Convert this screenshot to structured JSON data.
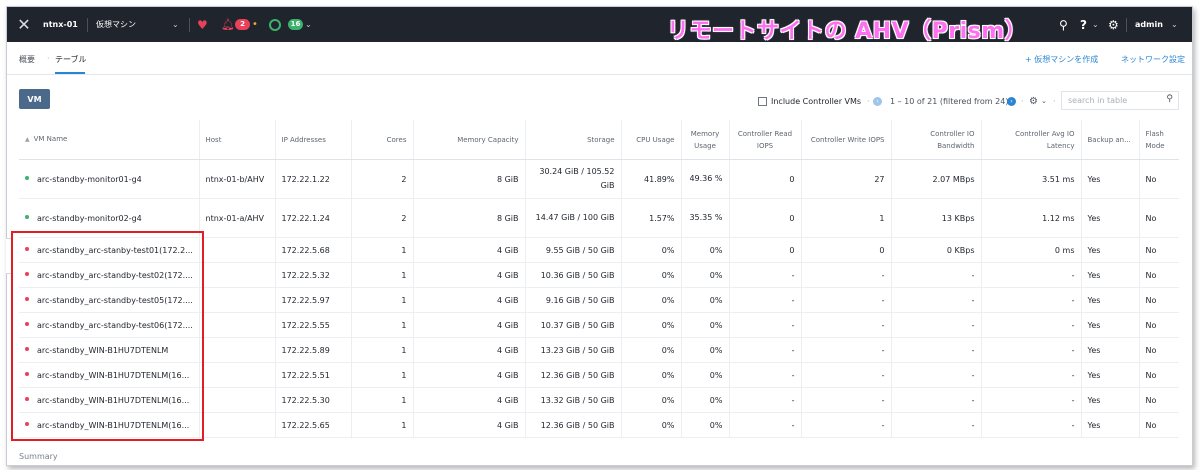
{
  "topbar": {
    "cluster_name": "ntnx-01",
    "menu_label": "仮想マシン",
    "alert_count": "2",
    "task_count": "16",
    "user": "admin",
    "icons": [
      "nutanix-x-logo",
      "heart-icon",
      "bell-icon",
      "circle-icon",
      "search-icon",
      "help-icon",
      "gear-icon"
    ]
  },
  "overlay_title": "リモートサイトの AHV（Prism）",
  "subbar": {
    "tabs": [
      "概要",
      "テーブル"
    ],
    "create_vm": "+ 仮想マシンを作成",
    "network_settings": "ネットワーク設定"
  },
  "toolbar": {
    "vm_tab": "VM",
    "include_controller_vms": "Include Controller VMs",
    "pagination": "1 – 10 of 21 (filtered from 24)",
    "search_placeholder": "search in table"
  },
  "table": {
    "columns": [
      "VM Name",
      "Host",
      "IP Addresses",
      "Cores",
      "Memory Capacity",
      "Storage",
      "CPU Usage",
      "Memory Usage",
      "Controller Read IOPS",
      "Controller Write IOPS",
      "Controller IO Bandwidth",
      "Controller Avg IO Latency",
      "Backup an...",
      "Flash Mode"
    ],
    "rows": [
      {
        "name": "arc-standby-monitor01-g4",
        "host": "ntnx-01-b/AHV",
        "ip": "172.22.1.22",
        "cores": "2",
        "memory": "8 GiB",
        "storage": "30.24 GiB / 105.52 GiB",
        "cpu": "41.89%",
        "mem_usage": "49.36 %",
        "read_iops": "0",
        "write_iops": "27",
        "io_bw": "2.07 MBps",
        "latency": "3.51 ms",
        "backup": "Yes",
        "flash": "No"
      },
      {
        "name": "arc-standby-monitor02-g4",
        "host": "ntnx-01-a/AHV",
        "ip": "172.22.1.24",
        "cores": "2",
        "memory": "8 GiB",
        "storage": "14.47 GiB / 100 GiB",
        "cpu": "1.57%",
        "mem_usage": "35.35 %",
        "read_iops": "0",
        "write_iops": "1",
        "io_bw": "13 KBps",
        "latency": "1.12 ms",
        "backup": "Yes",
        "flash": "No"
      },
      {
        "name": "arc-standby_arc-stanby-test01(172.2...",
        "host": "",
        "ip": "172.22.5.68",
        "cores": "1",
        "memory": "4 GiB",
        "storage": "9.55 GiB / 50 GiB",
        "cpu": "0%",
        "mem_usage": "0%",
        "read_iops": "0",
        "write_iops": "0",
        "io_bw": "0 KBps",
        "latency": "0 ms",
        "backup": "Yes",
        "flash": "No"
      },
      {
        "name": "arc-standby_arc-standby-test02(172....",
        "host": "",
        "ip": "172.22.5.32",
        "cores": "1",
        "memory": "4 GiB",
        "storage": "10.36 GiB / 50 GiB",
        "cpu": "0%",
        "mem_usage": "0%",
        "read_iops": "-",
        "write_iops": "-",
        "io_bw": "-",
        "latency": "-",
        "backup": "Yes",
        "flash": "No"
      },
      {
        "name": "arc-standby_arc-standby-test05(172....",
        "host": "",
        "ip": "172.22.5.97",
        "cores": "1",
        "memory": "4 GiB",
        "storage": "9.16 GiB / 50 GiB",
        "cpu": "0%",
        "mem_usage": "0%",
        "read_iops": "-",
        "write_iops": "-",
        "io_bw": "-",
        "latency": "-",
        "backup": "Yes",
        "flash": "No"
      },
      {
        "name": "arc-standby_arc-standby-test06(172....",
        "host": "",
        "ip": "172.22.5.55",
        "cores": "1",
        "memory": "4 GiB",
        "storage": "10.37 GiB / 50 GiB",
        "cpu": "0%",
        "mem_usage": "0%",
        "read_iops": "-",
        "write_iops": "-",
        "io_bw": "-",
        "latency": "-",
        "backup": "Yes",
        "flash": "No"
      },
      {
        "name": "arc-standby_WIN-B1HU7DTENLM",
        "host": "",
        "ip": "172.22.5.89",
        "cores": "1",
        "memory": "4 GiB",
        "storage": "13.23 GiB / 50 GiB",
        "cpu": "0%",
        "mem_usage": "0%",
        "read_iops": "-",
        "write_iops": "-",
        "io_bw": "-",
        "latency": "-",
        "backup": "Yes",
        "flash": "No"
      },
      {
        "name": "arc-standby_WIN-B1HU7DTENLM(16...",
        "host": "",
        "ip": "172.22.5.51",
        "cores": "1",
        "memory": "4 GiB",
        "storage": "12.36 GiB / 50 GiB",
        "cpu": "0%",
        "mem_usage": "0%",
        "read_iops": "-",
        "write_iops": "-",
        "io_bw": "-",
        "latency": "-",
        "backup": "Yes",
        "flash": "No"
      },
      {
        "name": "arc-standby_WIN-B1HU7DTENLM(16...",
        "host": "",
        "ip": "172.22.5.30",
        "cores": "1",
        "memory": "4 GiB",
        "storage": "13.32 GiB / 50 GiB",
        "cpu": "0%",
        "mem_usage": "0%",
        "read_iops": "-",
        "write_iops": "-",
        "io_bw": "-",
        "latency": "-",
        "backup": "Yes",
        "flash": "No"
      },
      {
        "name": "arc-standby_WIN-B1HU7DTENLM(16...",
        "host": "",
        "ip": "172.22.5.65",
        "cores": "1",
        "memory": "4 GiB",
        "storage": "12.36 GiB / 50 GiB",
        "cpu": "0%",
        "mem_usage": "0%",
        "read_iops": "-",
        "write_iops": "-",
        "io_bw": "-",
        "latency": "-",
        "backup": "Yes",
        "flash": "No"
      }
    ],
    "status_colors": {
      "on": "#3cb26c",
      "off": "#e9415a"
    },
    "row_status": [
      "on",
      "on",
      "off",
      "off",
      "off",
      "off",
      "off",
      "off",
      "off",
      "off"
    ]
  },
  "summary_label": "Summary",
  "colors": {
    "topbar": "#20252d",
    "accent": "#2a86d4",
    "highlight_box": "#e01e26",
    "overlay_text": "#ff6ff2"
  }
}
